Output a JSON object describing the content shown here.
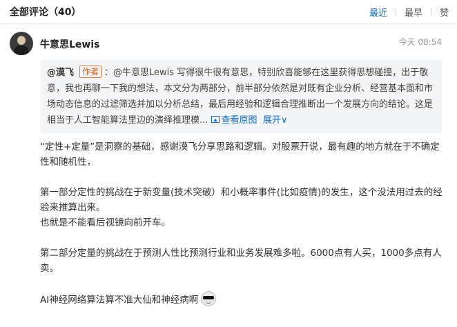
{
  "header": {
    "title": "全部评论（40）",
    "sort_tabs": [
      "最近",
      "最早",
      "赞"
    ],
    "active_tab": "最近"
  },
  "comment": {
    "author": "牛意思Lewis",
    "time": "今天 08:54",
    "quote": {
      "author": "@漠飞",
      "badge": "作者",
      "text": "：@牛意思Lewis 写得很牛很有意思，特别欣喜能够在这里获得思想碰撞，出于敬意，我也再聊一下我的想法，本文分为两部分，前半部分依然是对既有企业分析、经营基本面和市场动态信息的过滤筛选并加以分析总结，最后用经验和逻辑合理推断出一个发展方向的结论。这是相当于人工智能算法里边的演绎推理模...",
      "view_image": "查看原图",
      "expand": "展开"
    },
    "paragraphs": [
      "“定性+定量”是洞察的基础，感谢漠飞分享思路和逻辑。对股票开说，最有趣的地方就在于不确定性和随机性，",
      "第一部分定性的挑战在于新变量(技术突破）和小概率事件(比如疫情)的发生，这个没法用过去的经验来推算出来。",
      "也就是不能看后视镜向前开车。",
      "第二部分定量的挑战在于预测人性比预测行业和业务发展难多啦。6000点有人买，1000多点有人卖。",
      "AI神经网络算法算不准大仙和神经病啊"
    ]
  }
}
